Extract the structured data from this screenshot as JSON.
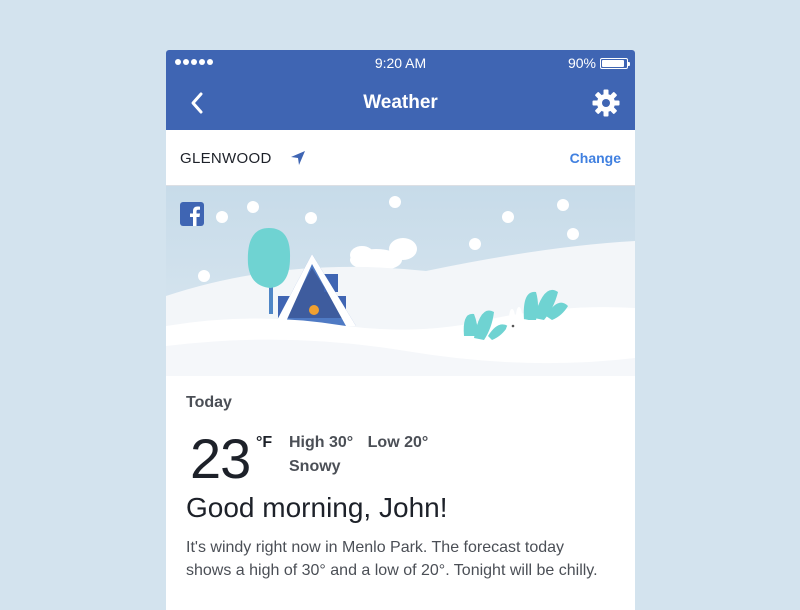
{
  "status_bar": {
    "time": "9:20 AM",
    "battery_text": "90%",
    "battery_level": 0.9
  },
  "nav": {
    "title": "Weather",
    "back_icon": "chevron-left-icon",
    "settings_icon": "gear-icon"
  },
  "location": {
    "name": "GLENWOOD",
    "icon": "location-arrow-icon",
    "change_label": "Change"
  },
  "colors": {
    "brand": "#3f65b3",
    "link": "#4080e0",
    "page_background": "#d3e3ee"
  },
  "weather": {
    "day_label": "Today",
    "temperature": "23",
    "unit": "°F",
    "high": "High 30°",
    "low": "Low 20°",
    "condition": "Snowy",
    "greeting": "Good morning, John!",
    "forecast": "It's windy right now in Menlo Park. The forecast today shows a high of 30° and a low of 20°. Tonight will be chilly."
  }
}
